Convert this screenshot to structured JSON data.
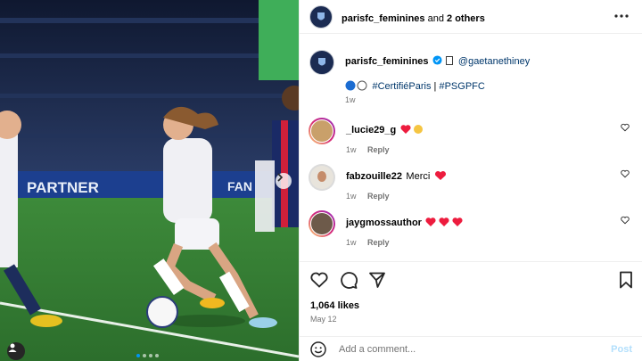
{
  "header": {
    "account": "parisfc_feminines",
    "and_text": " and ",
    "others": "2 others",
    "more_icon": "more-horizontal-icon"
  },
  "caption": {
    "username": "parisfc_feminines",
    "verified_icon": "verified-badge-icon",
    "flag_icon": "flag-icon",
    "mention": "@gaetanethiney",
    "circles": [
      "blue-circle-emoji",
      "white-circle-emoji"
    ],
    "hashtag1": "#CertifiéParis",
    "separator": " | ",
    "hashtag2": "#PSGPFC",
    "time": "1w"
  },
  "comments": [
    {
      "username": "_lucie29_g",
      "text": "",
      "emoji": [
        "red-heart-emoji",
        "clapping-hands-emoji"
      ],
      "time": "1w",
      "reply": "Reply"
    },
    {
      "username": "fabzouille22",
      "text": "Merci",
      "emoji": [
        "red-heart-emoji"
      ],
      "time": "1w",
      "reply": "Reply"
    },
    {
      "username": "jaygmossauthor",
      "text": "",
      "emoji": [
        "red-heart-emoji",
        "red-heart-emoji",
        "red-heart-emoji"
      ],
      "time": "1w",
      "reply": "Reply"
    }
  ],
  "actions": {
    "likes": "1,064 likes",
    "date": "May 12"
  },
  "add_comment": {
    "placeholder": "Add a comment...",
    "post": "Post",
    "emoji_icon": "smiley-icon"
  },
  "photo": {
    "banner_text": "PARTNER",
    "banner_text2": "FAN",
    "carousel_dots": 4,
    "active_dot": 0
  },
  "colors": {
    "link": "#00376b",
    "verified": "#0095f6",
    "heart": "#ed1c3e",
    "post_disabled": "#b2dffc"
  }
}
